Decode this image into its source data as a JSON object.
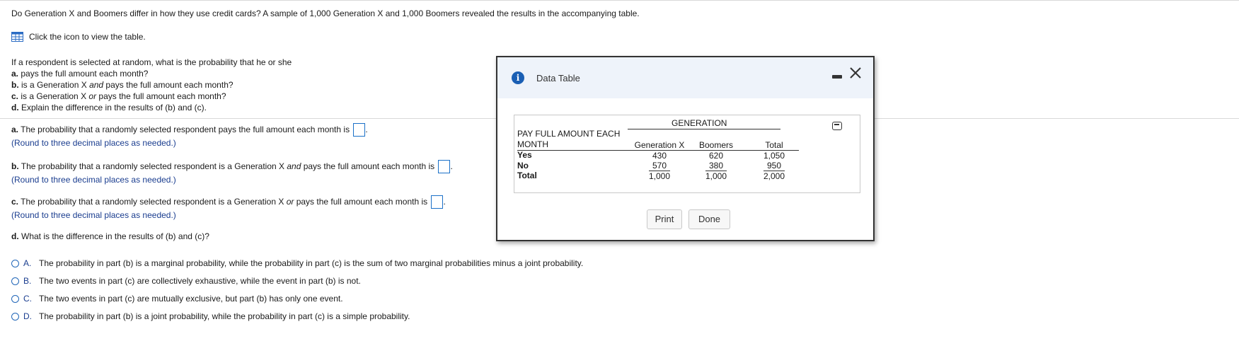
{
  "intro": "Do Generation X and Boomers differ in how they use credit cards? A sample of 1,000 Generation X and 1,000 Boomers revealed the results in the accompanying table.",
  "table_link": "Click the icon to view the table.",
  "questions": {
    "lead": "If a respondent is selected at random, what is the probability that he or she",
    "a_label": "a.",
    "a_text": " pays the full amount each month?",
    "b_label": "b.",
    "b_text_1": " is a Generation X ",
    "b_em": "and",
    "b_text_2": " pays the full amount each month?",
    "c_label": "c.",
    "c_text_1": " is a Generation X ",
    "c_em": "or",
    "c_text_2": " pays the full amount each month?",
    "d_label": "d.",
    "d_text": " Explain the difference in the results of (b) and (c)."
  },
  "parts": {
    "a_label": "a.",
    "a_text": " The probability that a randomly selected respondent pays the full amount each month is ",
    "a_hint": "(Round to three decimal places as needed.)",
    "b_label": "b.",
    "b_text_1": " The probability that a randomly selected respondent is a Generation X ",
    "b_em": "and",
    "b_text_2": " pays the full amount each month is ",
    "b_hint": "(Round to three decimal places as needed.)",
    "c_label": "c.",
    "c_text_1": " The probability that a randomly selected respondent is a Generation X ",
    "c_em": "or",
    "c_text_2": " pays the full amount each month is ",
    "c_hint": "(Round to three decimal places as needed.)",
    "d_label": "d.",
    "d_text": " What is the difference in the results of (b) and (c)?",
    "period": "."
  },
  "choices": [
    {
      "letter": "A.",
      "text": "The probability in part (b) is a marginal probability, while the probability in part (c) is the sum of two marginal probabilities minus a joint probability."
    },
    {
      "letter": "B.",
      "text": "The two events in part (c) are collectively exhaustive, while the event in part (b) is not."
    },
    {
      "letter": "C.",
      "text": "The two events in part (c) are mutually exclusive, but part (b) has only one event."
    },
    {
      "letter": "D.",
      "text": "The probability in part (b) is a joint probability, while the probability in part (c) is a simple probability."
    }
  ],
  "dialog": {
    "title": "Data Table",
    "info_glyph": "i",
    "table": {
      "group_header": "GENERATION",
      "row_header_1": "PAY FULL AMOUNT EACH",
      "row_header_2": "MONTH",
      "columns": [
        "Generation X",
        "Boomers",
        "Total"
      ],
      "rows": [
        {
          "label": "Yes",
          "values": [
            "430",
            "620",
            "1,050"
          ]
        },
        {
          "label": "No",
          "values": [
            "570",
            "380",
            "950"
          ]
        },
        {
          "label": "Total",
          "values": [
            "1,000",
            "1,000",
            "2,000"
          ]
        }
      ]
    },
    "print_label": "Print",
    "done_label": "Done"
  },
  "colors": {
    "accent": "#1a5fb4",
    "hint": "#1a3d8f",
    "dialog_header": "#eef3fa"
  }
}
